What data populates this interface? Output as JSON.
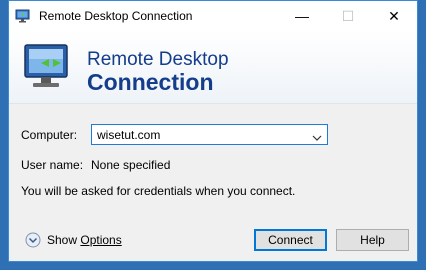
{
  "window": {
    "title": "Remote Desktop Connection",
    "controls": {
      "minimize": "—",
      "maximize": "☐",
      "close": "✕"
    }
  },
  "banner": {
    "line1": "Remote Desktop",
    "line2": "Connection"
  },
  "form": {
    "computer_label": "Computer:",
    "computer_value": "wisetut.com",
    "username_label": "User name:",
    "username_value": "None specified",
    "credentials_note": "You will be asked for credentials when you connect."
  },
  "footer": {
    "show_options_prefix": "Show ",
    "show_options_rest": "Options",
    "connect_label": "Connect",
    "help_label": "Help"
  },
  "colors": {
    "accent": "#0078d7",
    "banner_text": "#143d8c",
    "dialog_bg": "#f0f0f0",
    "desktop_bg": "#2f6fb3"
  },
  "icons": [
    "remote-desktop-icon",
    "monitor-icon",
    "chevron-down-icon",
    "expand-circle-icon"
  ]
}
